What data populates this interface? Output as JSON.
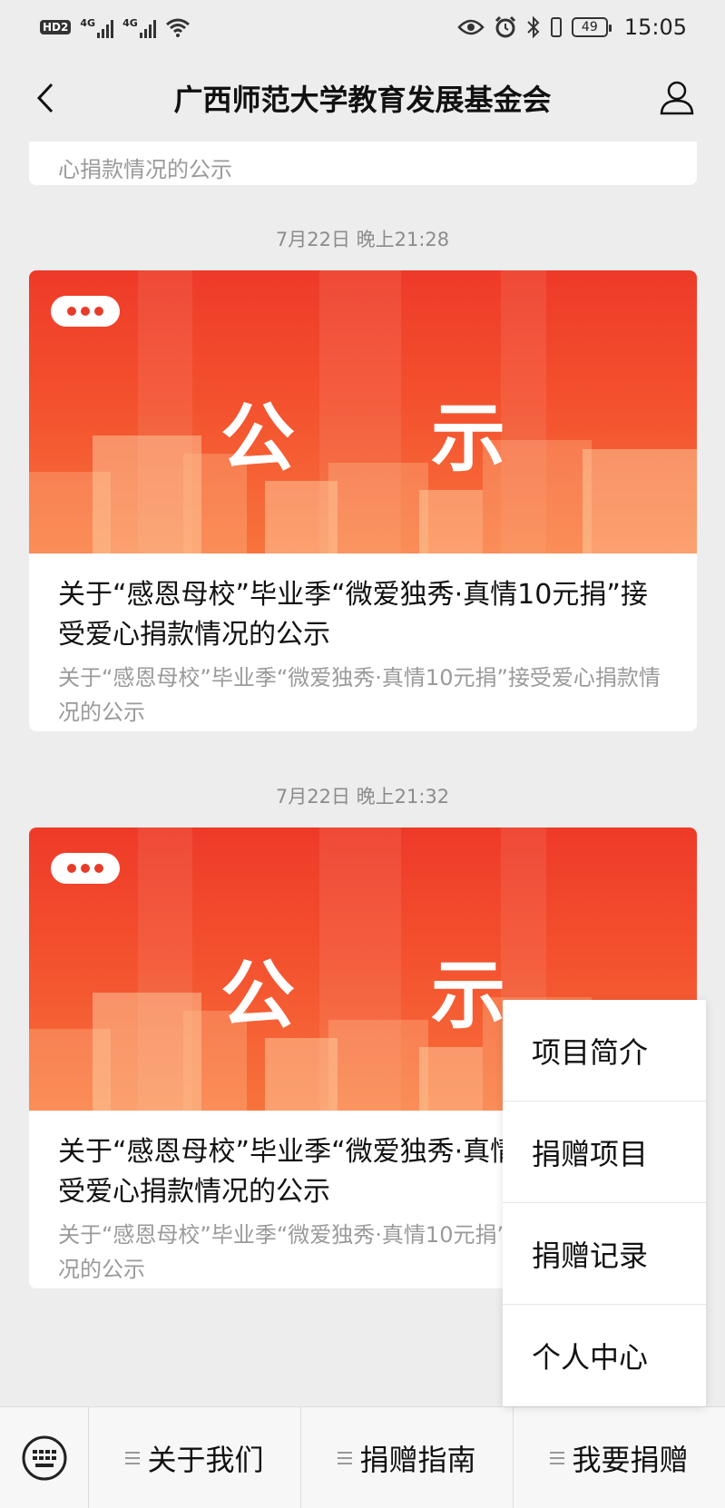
{
  "status_bar": {
    "hd_label": "HD",
    "hd_num": "2",
    "net1": "4G",
    "net2": "4G",
    "battery": "49",
    "time": "15:05"
  },
  "header": {
    "title": "广西师范大学教育发展基金会"
  },
  "feed": {
    "prev_desc_tail": "心捐款情况的公示",
    "items": [
      {
        "time": "7月22日 晚上21:28",
        "cover_text": "公示",
        "title": "关于“感恩母校”毕业季“微爱独秀·真情10元捐”接受爱心捐款情况的公示",
        "desc": "关于“感恩母校”毕业季“微爱独秀·真情10元捐”接受爱心捐款情况的公示"
      },
      {
        "time": "7月22日 晚上21:32",
        "cover_text": "公示",
        "title": "关于“感恩母校”毕业季“微爱独秀·真情10元捐”接受爱心捐款情况的公示",
        "desc": "关于“感恩母校”毕业季“微爱独秀·真情10元捐”接受爱心捐款情况的公示"
      }
    ]
  },
  "popup_menu": {
    "items": [
      "项目简介",
      "捐赠项目",
      "捐赠记录",
      "个人中心"
    ]
  },
  "bottom_menu": {
    "items": [
      "关于我们",
      "捐赠指南",
      "我要捐赠"
    ]
  },
  "colors": {
    "cover_red": "#ee3a28",
    "background": "#ededed"
  }
}
